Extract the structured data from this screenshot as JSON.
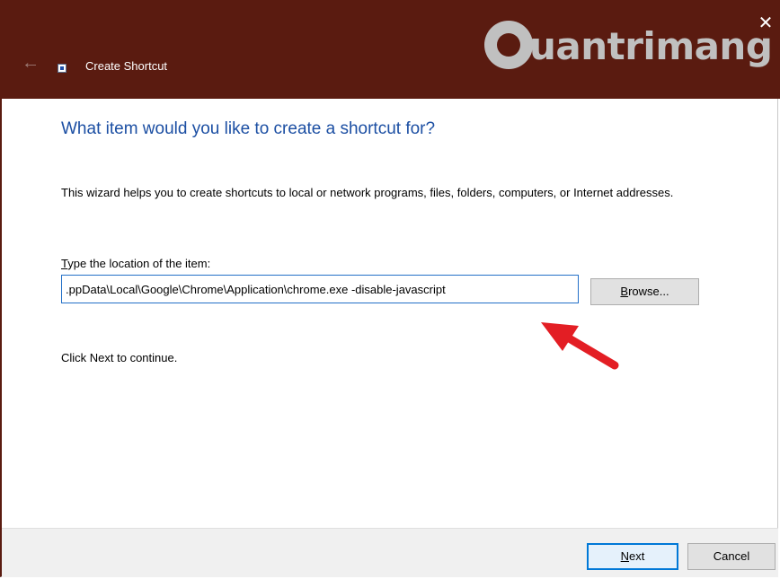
{
  "window": {
    "title": "Create Shortcut",
    "back_glyph": "←",
    "close_glyph": "✕",
    "titlebar_color": "#5a1b10"
  },
  "watermark": {
    "text": "uantrimang"
  },
  "wizard": {
    "heading": "What item would you like to create a shortcut for?",
    "description": "This wizard helps you to create shortcuts to local or network programs, files, folders, computers, or Internet addresses.",
    "field_label_first": "T",
    "field_label_rest": "ype the location of the item:",
    "location_value": ".ppData\\Local\\Google\\Chrome\\Application\\chrome.exe -disable-javascript",
    "browse_first": "B",
    "browse_rest": "rowse...",
    "hint": "Click Next to continue."
  },
  "footer": {
    "next_first": "N",
    "next_rest": "ext",
    "cancel_label": "Cancel"
  },
  "colors": {
    "heading": "#1c4fa3",
    "focus_border": "#0078d7",
    "annotation_arrow": "#e31e24"
  }
}
